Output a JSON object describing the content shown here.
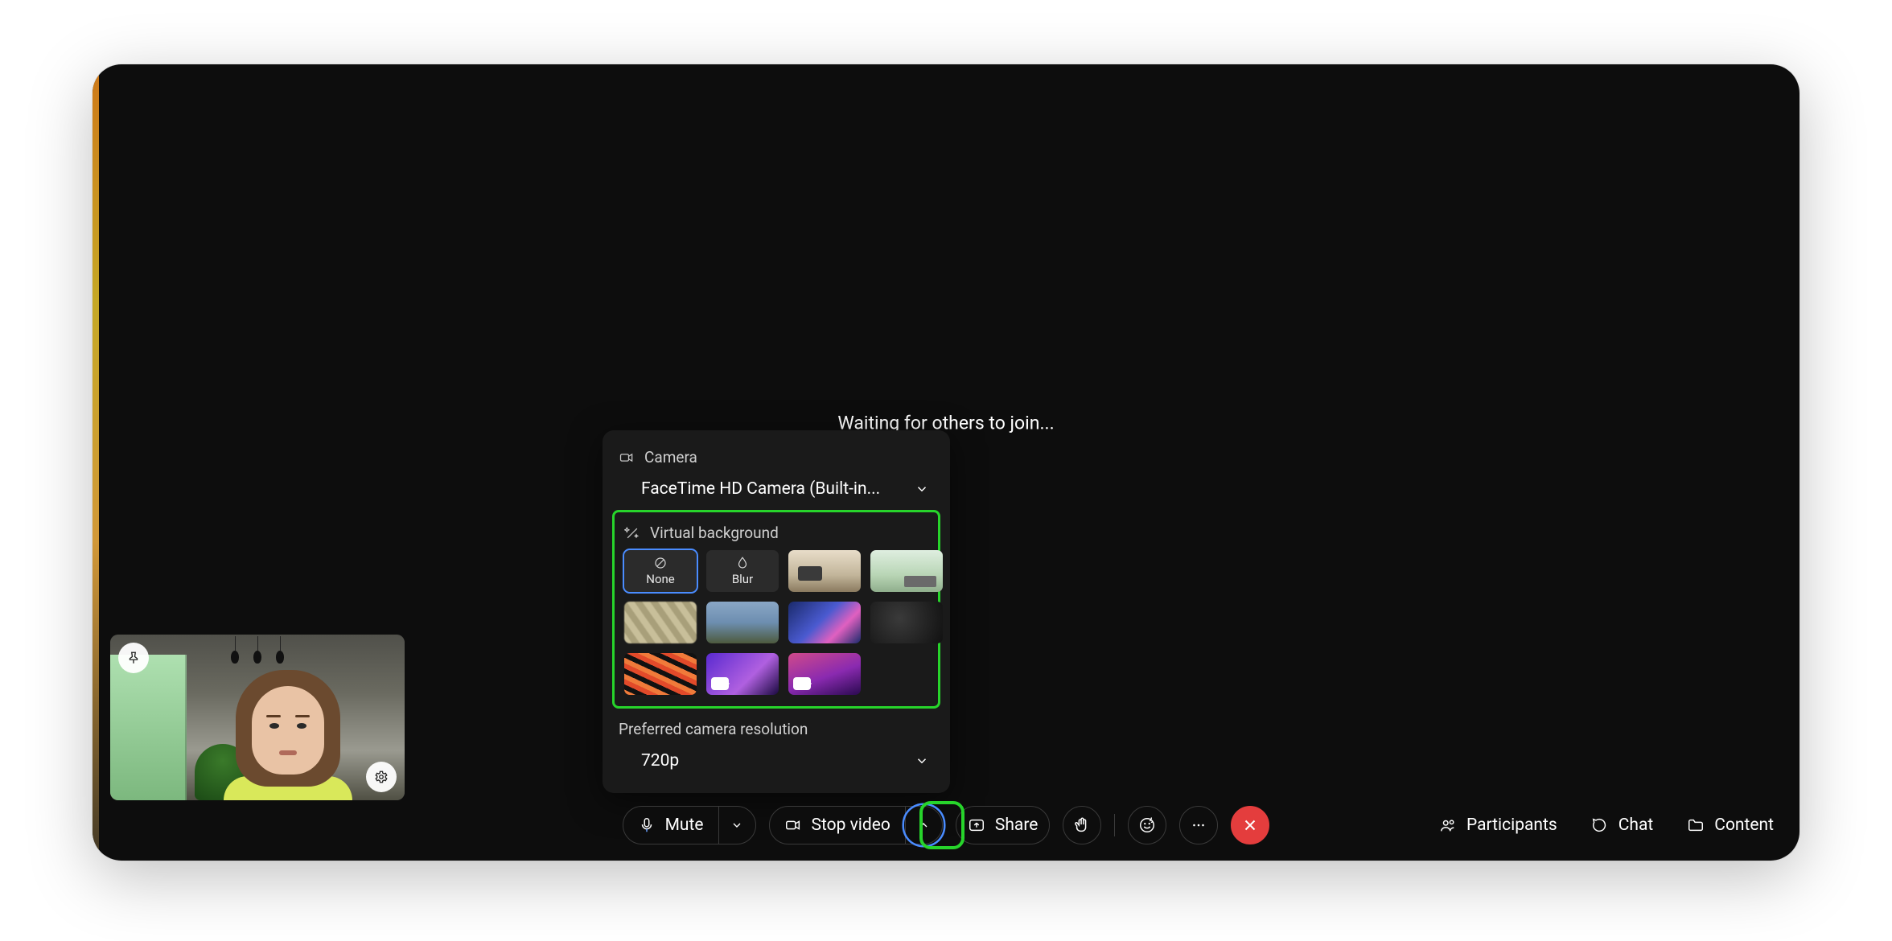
{
  "status_text": "Waiting for others to join...",
  "toolbar": {
    "mute_label": "Mute",
    "stop_video_label": "Stop video",
    "share_label": "Share",
    "participants_label": "Participants",
    "chat_label": "Chat",
    "content_label": "Content"
  },
  "popover": {
    "camera_section_label": "Camera",
    "camera_selected": "FaceTime HD Camera (Built-in...",
    "virtual_bg_section_label": "Virtual background",
    "virtual_bg_options": {
      "none": "None",
      "blur": "Blur"
    },
    "resolution_section_label": "Preferred camera resolution",
    "resolution_selected": "720p"
  },
  "highlight_colors": {
    "annotation": "#27d42b",
    "selection": "#4a8cff"
  }
}
